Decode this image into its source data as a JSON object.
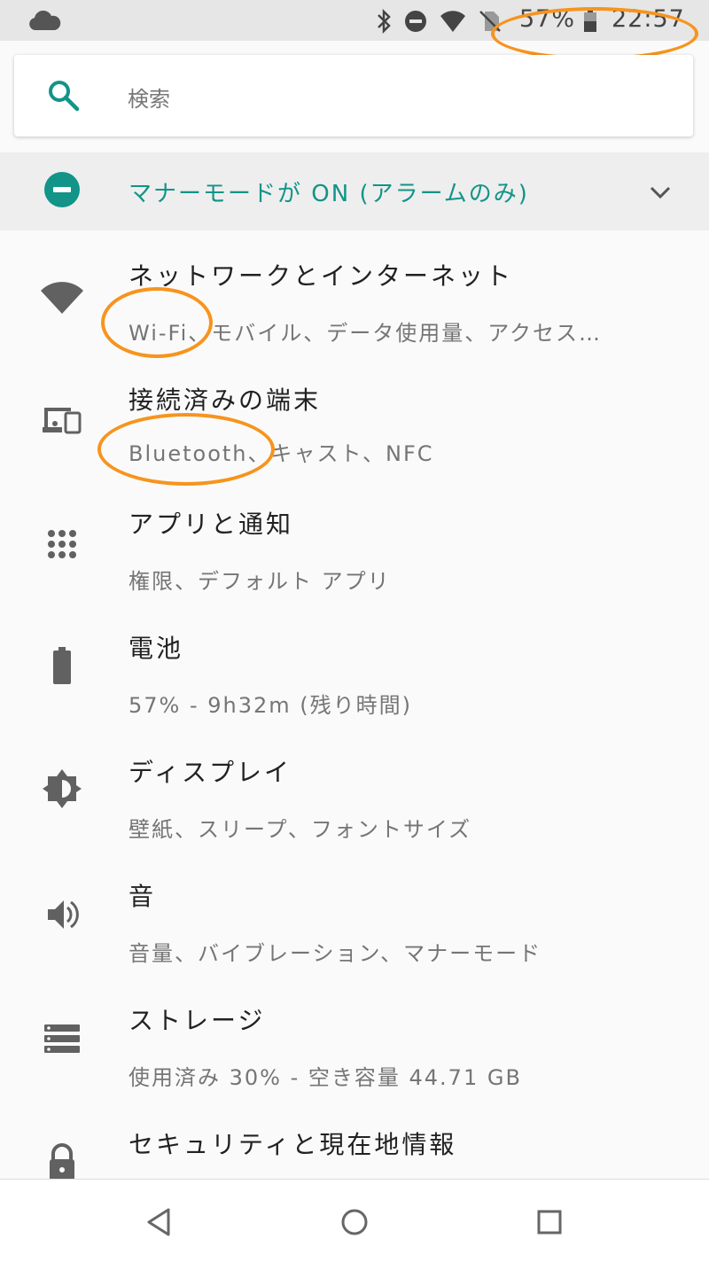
{
  "status_bar": {
    "battery_percent": "57%",
    "time": "22:57",
    "icons": [
      "cloud-icon",
      "bluetooth-icon",
      "dnd-icon",
      "wifi-icon",
      "no-sim-icon",
      "battery-icon"
    ]
  },
  "search": {
    "placeholder": "検索"
  },
  "dnd_banner": {
    "text": "マナーモードが ON (アラームのみ)"
  },
  "settings": [
    {
      "title": "ネットワークとインターネット",
      "subtitle": "Wi-Fi、モバイル、データ使用量、アクセス…",
      "icon": "wifi-icon"
    },
    {
      "title": "接続済みの端末",
      "subtitle": "Bluetooth、キャスト、NFC",
      "icon": "devices-icon"
    },
    {
      "title": "アプリと通知",
      "subtitle": "権限、デフォルト アプリ",
      "icon": "apps-icon"
    },
    {
      "title": "電池",
      "subtitle": "57% - 9h32m (残り時間)",
      "icon": "battery-icon"
    },
    {
      "title": "ディスプレイ",
      "subtitle": "壁紙、スリープ、フォントサイズ",
      "icon": "brightness-icon"
    },
    {
      "title": "音",
      "subtitle": "音量、バイブレーション、マナーモード",
      "icon": "volume-icon"
    },
    {
      "title": "ストレージ",
      "subtitle": "使用済み 30% - 空き容量 44.71 GB",
      "icon": "storage-icon"
    },
    {
      "title": "セキュリティと現在地情報",
      "subtitle": "",
      "icon": "lock-icon"
    }
  ],
  "colors": {
    "accent": "#129488",
    "highlight": "#f7941d",
    "icon_gray": "#616161"
  }
}
